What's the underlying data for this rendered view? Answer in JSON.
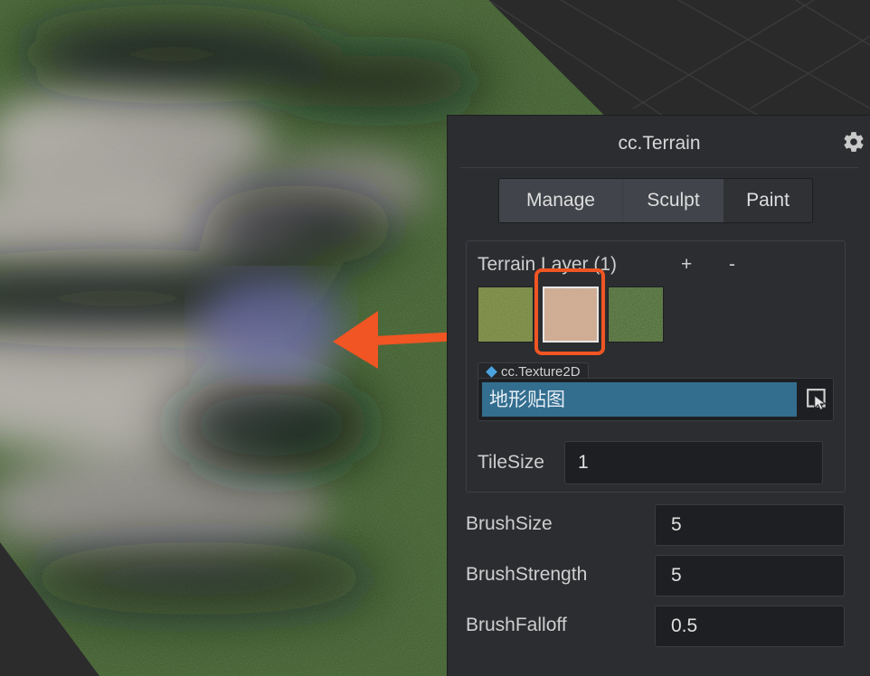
{
  "panel": {
    "title": "cc.Terrain",
    "icons": {
      "settings": "gear-icon"
    }
  },
  "tabs": [
    {
      "label": "Manage",
      "active": true
    },
    {
      "label": "Sculpt",
      "active": false
    },
    {
      "label": "Paint",
      "active": false
    }
  ],
  "terrain_layer": {
    "label": "Terrain Layer (1)",
    "add_label": "+",
    "remove_label": "-",
    "selected_index": 1,
    "textures": [
      {
        "name": "grass-yellow"
      },
      {
        "name": "sand"
      },
      {
        "name": "grass-green"
      }
    ],
    "asset_type": "cc.Texture2D",
    "asset_value": "地形贴图",
    "tile_size_label": "TileSize",
    "tile_size_value": "1"
  },
  "brush": [
    {
      "label": "BrushSize",
      "value": "5"
    },
    {
      "label": "BrushStrength",
      "value": "5"
    },
    {
      "label": "BrushFalloff",
      "value": "0.5"
    }
  ],
  "colors": {
    "highlight": "#f05523",
    "asset_bg": "#336e8f",
    "panel_bg": "#2b2d30"
  }
}
